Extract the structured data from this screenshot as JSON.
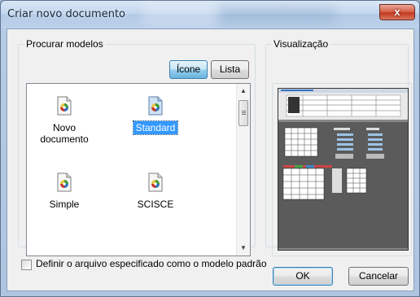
{
  "window": {
    "title": "Criar novo documento",
    "close_label": "x"
  },
  "templates_group": {
    "label": "Procurar modelos",
    "view_buttons": [
      {
        "label": "Ícone",
        "active": true
      },
      {
        "label": "Lista",
        "active": false
      }
    ],
    "items": [
      {
        "label": "Novo documento",
        "selected": false
      },
      {
        "label": "Standard",
        "selected": true
      },
      {
        "label": "Simple",
        "selected": false
      },
      {
        "label": "SCISCE",
        "selected": false
      }
    ]
  },
  "preview_group": {
    "label": "Visualização"
  },
  "default_checkbox": {
    "label": "Definir o arquivo especificado como o modelo padrão",
    "checked": false
  },
  "buttons": {
    "ok": "OK",
    "cancel": "Cancelar"
  },
  "colors": {
    "selection": "#3399ff",
    "close_button": "#c23a22",
    "preview_background": "#5b5b5b"
  },
  "icons": {
    "document": "document-with-color-wheel-icon"
  }
}
